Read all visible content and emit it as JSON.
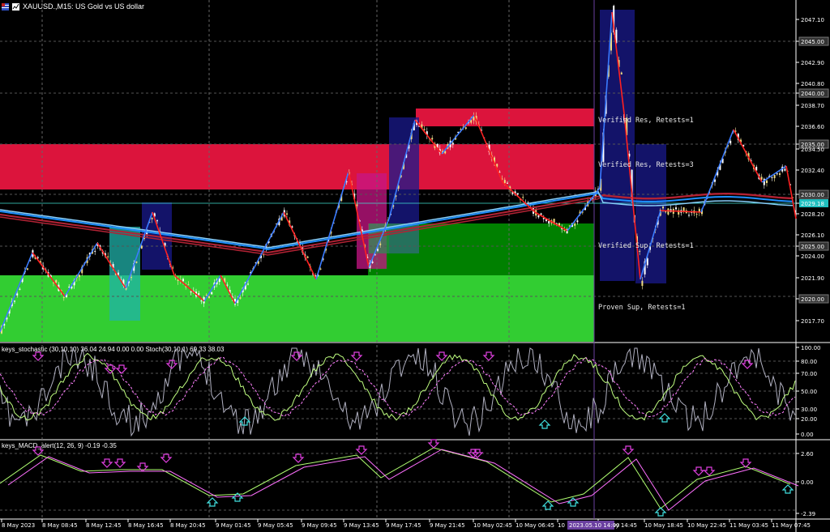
{
  "window": {
    "title": "XAUUSD.,M15:  US Gold vs US dollar",
    "flag_icon": "flag-icon",
    "chart_icon": "chart-icon"
  },
  "price_scale": {
    "ticks": [
      "2047.10",
      "2045.00",
      "2042.90",
      "2040.80",
      "2040.00",
      "2038.70",
      "2036.60",
      "2035.00",
      "2034.50",
      "2032.40",
      "2030.00",
      "2029.18",
      "2028.20",
      "2026.10",
      "2025.00",
      "2024.00",
      "2021.90",
      "2020.00",
      "2017.70"
    ],
    "highlight_ticks": [
      "2045.00",
      "2040.00",
      "2035.00",
      "2030.00",
      "2025.00",
      "2020.00"
    ],
    "current_price": "2029.18"
  },
  "zones": {
    "labels": [
      "Verified Res, Retests=1",
      "Verified Res, Retests=3",
      "Verified Sup, Retests=1",
      "Proven Sup, Retests=1"
    ]
  },
  "stochastic": {
    "label": "keys_stochastic (30,10,10) 36.04 24.94 0.00 0.00  Stoch(30,10,1) 69.33 38.03",
    "ticks": [
      "100.00",
      "80.00",
      "70.00",
      "50.00",
      "30.00",
      "20.00",
      "0.00"
    ]
  },
  "macd": {
    "label": "keys_MACD_alert(12, 26, 9) -0.19 -0.35",
    "ticks": [
      "2.60",
      "0.00",
      "-2.39"
    ]
  },
  "time_axis": {
    "labels": [
      "8 May 2023",
      "8 May 08:45",
      "8 May 12:45",
      "8 May 16:45",
      "8 May 20:45",
      "9 May 01:45",
      "9 May 05:45",
      "9 May 09:45",
      "9 May 13:45",
      "9 May 17:45",
      "9 May 21:45",
      "10 May 02:45",
      "10 May 06:45",
      "10",
      "10 May 14:45",
      "10 May 18:45",
      "10 May 22:45",
      "11 May 03:45",
      "11 May 07:45"
    ],
    "cursor_label": "2023.05.10 14:00"
  },
  "colors": {
    "resistance": "#DC143C",
    "support_bright": "#32CD32",
    "support_dark": "#008000",
    "box_blue": "#1a1a8c",
    "box_magenta": "#c71585",
    "box_teal": "#20b2aa",
    "ma_red": "#b22234",
    "ma_blue": "#1e90ff",
    "zigzag_blue": "#3a7bff",
    "zigzag_red": "#ff2020",
    "arrow_down": "#e040e0",
    "arrow_up": "#40e0e0",
    "cursor": "#6a3fa0"
  }
}
